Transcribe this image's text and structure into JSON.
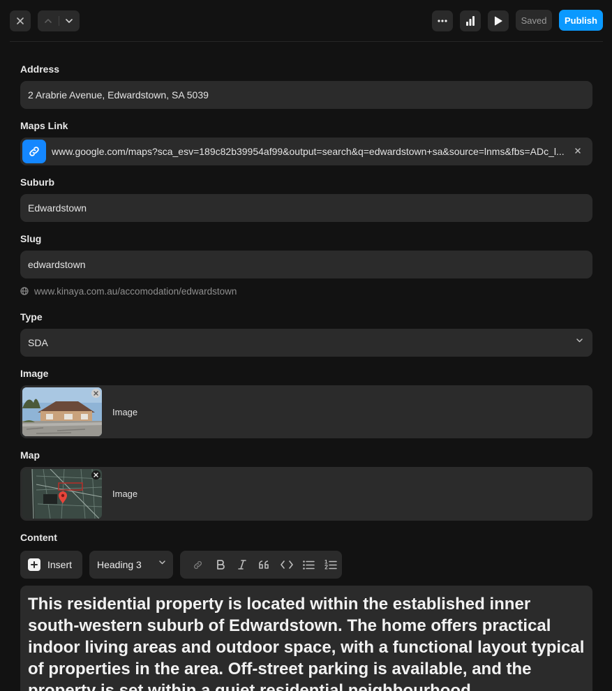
{
  "toolbar": {
    "close_icon": "close-icon",
    "prev_icon": "chevron-up-icon",
    "next_icon": "chevron-down-icon",
    "more_icon": "more-horizontal-icon",
    "analytics_icon": "bar-chart-icon",
    "preview_icon": "play-icon",
    "saved_label": "Saved",
    "publish_label": "Publish",
    "publish_color": "#0a99ff"
  },
  "form": {
    "address": {
      "label": "Address",
      "value": "2 Arabrie Avenue, Edwardstown, SA 5039"
    },
    "maps_link": {
      "label": "Maps Link",
      "value": "www.google.com/maps?sca_esv=189c82b39954af99&output=search&q=edwardstown+sa&source=lnms&fbs=ADc_l...",
      "icon": "link-icon"
    },
    "suburb": {
      "label": "Suburb",
      "value": "Edwardstown"
    },
    "slug": {
      "label": "Slug",
      "value": "edwardstown",
      "url_preview": "www.kinaya.com.au/accomodation/edwardstown",
      "url_icon": "globe-icon"
    },
    "type": {
      "label": "Type",
      "value": "SDA"
    },
    "image": {
      "label": "Image",
      "caption": "Image"
    },
    "map": {
      "label": "Map",
      "caption": "Image"
    }
  },
  "content": {
    "label": "Content",
    "insert_label": "Insert",
    "block_style": "Heading 3",
    "format_icons": [
      "link-icon",
      "bold-icon",
      "italic-icon",
      "quote-icon",
      "code-icon",
      "bullet-list-icon",
      "numbered-list-icon"
    ],
    "body": "This residential property is located within the established inner south-western suburb of Edwardstown. The home offers practical indoor living areas and outdoor space, with a functional layout typical of properties in the area. Off-street parking is available, and the property is set within a quiet residential neighbourhood."
  }
}
